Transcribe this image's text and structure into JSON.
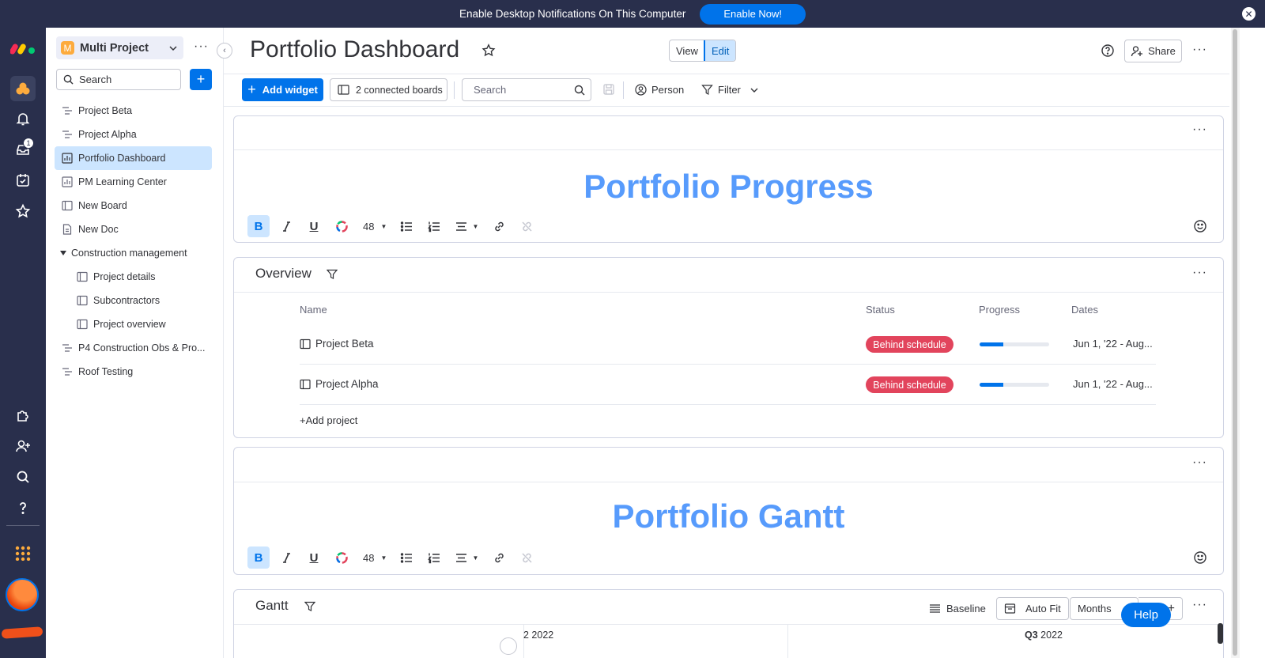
{
  "notification": {
    "message": "Enable Desktop Notifications On This Computer",
    "button": "Enable Now!"
  },
  "rail": {
    "inbox_badge": "1"
  },
  "sidebar": {
    "workspace_initial": "M",
    "workspace_name": "Multi Project",
    "search_placeholder": "Search",
    "items": [
      {
        "label": "Project Beta",
        "icon": "project-icon"
      },
      {
        "label": "Project Alpha",
        "icon": "project-icon"
      },
      {
        "label": "Portfolio Dashboard",
        "icon": "dashboard-icon",
        "active": true
      },
      {
        "label": "PM Learning Center",
        "icon": "dashboard-icon"
      },
      {
        "label": "New Board",
        "icon": "board-icon"
      },
      {
        "label": "New Doc",
        "icon": "doc-icon"
      },
      {
        "label": "Construction management",
        "icon": "folder-caret"
      },
      {
        "label": "Project details",
        "icon": "board-icon"
      },
      {
        "label": "Subcontractors",
        "icon": "board-icon"
      },
      {
        "label": "Project overview",
        "icon": "board-icon"
      },
      {
        "label": "P4 Construction Obs & Pro...",
        "icon": "project-icon"
      },
      {
        "label": "Roof Testing",
        "icon": "project-icon"
      }
    ]
  },
  "header": {
    "title": "Portfolio Dashboard",
    "view_label": "View",
    "edit_label": "Edit",
    "share_label": "Share"
  },
  "toolbar": {
    "add_widget": "Add widget",
    "connected_boards": "2 connected boards",
    "search_placeholder": "Search",
    "person": "Person",
    "filter": "Filter"
  },
  "widgets": {
    "progress_title": "Portfolio Progress",
    "font_size": "48",
    "overview": {
      "title": "Overview",
      "columns": {
        "name": "Name",
        "status": "Status",
        "progress": "Progress",
        "dates": "Dates"
      },
      "rows": [
        {
          "name": "Project Beta",
          "status": "Behind schedule",
          "progress": 0.34,
          "dates": "Jun 1, '22 - Aug..."
        },
        {
          "name": "Project Alpha",
          "status": "Behind schedule",
          "progress": 0.34,
          "dates": "Jun 1, '22 - Aug..."
        }
      ],
      "add_project": "+Add project"
    },
    "gantt_title_text": "Portfolio Gantt",
    "gantt": {
      "title": "Gantt",
      "baseline": "Baseline",
      "auto_fit": "Auto Fit",
      "months": "Months",
      "q_left": "2 2022",
      "q_right_bold": "Q3",
      "q_right_year": "2022"
    }
  },
  "help_button": "Help",
  "colors": {
    "accent": "#0073ea",
    "status_red": "#e2445c",
    "title_blue": "#579bfc",
    "rail": "#292f4c"
  }
}
